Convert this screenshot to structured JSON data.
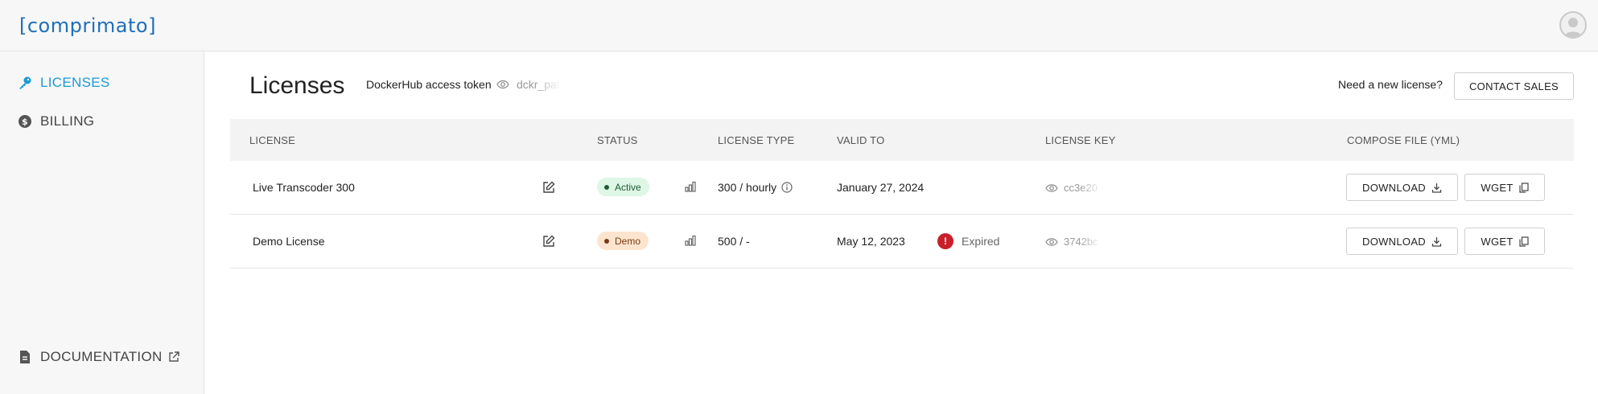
{
  "brand": {
    "logo_text": "[comprimato]",
    "accent": "#1a9ad6"
  },
  "sidebar": {
    "items": [
      {
        "label": "LICENSES",
        "icon": "key-icon",
        "active": true
      },
      {
        "label": "BILLING",
        "icon": "dollar-icon",
        "active": false
      }
    ],
    "footer": {
      "label": "DOCUMENTATION",
      "icon": "document-icon",
      "trailing_icon": "external-link-icon"
    }
  },
  "header": {
    "title": "Licenses",
    "token_label": "DockerHub access token",
    "token_value": "dckr_pat",
    "need_label": "Need a new license?",
    "contact_label": "CONTACT SALES"
  },
  "table": {
    "columns": [
      "LICENSE",
      "STATUS",
      "LICENSE TYPE",
      "VALID TO",
      "LICENSE KEY",
      "COMPOSE FILE (YML)"
    ],
    "rows": [
      {
        "name": "Live Transcoder 300",
        "status": "Active",
        "type": "300 / hourly",
        "valid_to": "January 27, 2024",
        "expired_label": "",
        "key": "cc3e20",
        "download": "DOWNLOAD",
        "wget": "WGET"
      },
      {
        "name": "Demo License",
        "status": "Demo",
        "type": "500 / -",
        "valid_to": "May 12, 2023",
        "expired_label": "Expired",
        "key": "3742bc",
        "download": "DOWNLOAD",
        "wget": "WGET"
      }
    ]
  },
  "colors": {
    "active_badge_bg": "#dff7e6",
    "demo_badge_bg": "#fde4cf",
    "expired_red": "#c8202b"
  }
}
